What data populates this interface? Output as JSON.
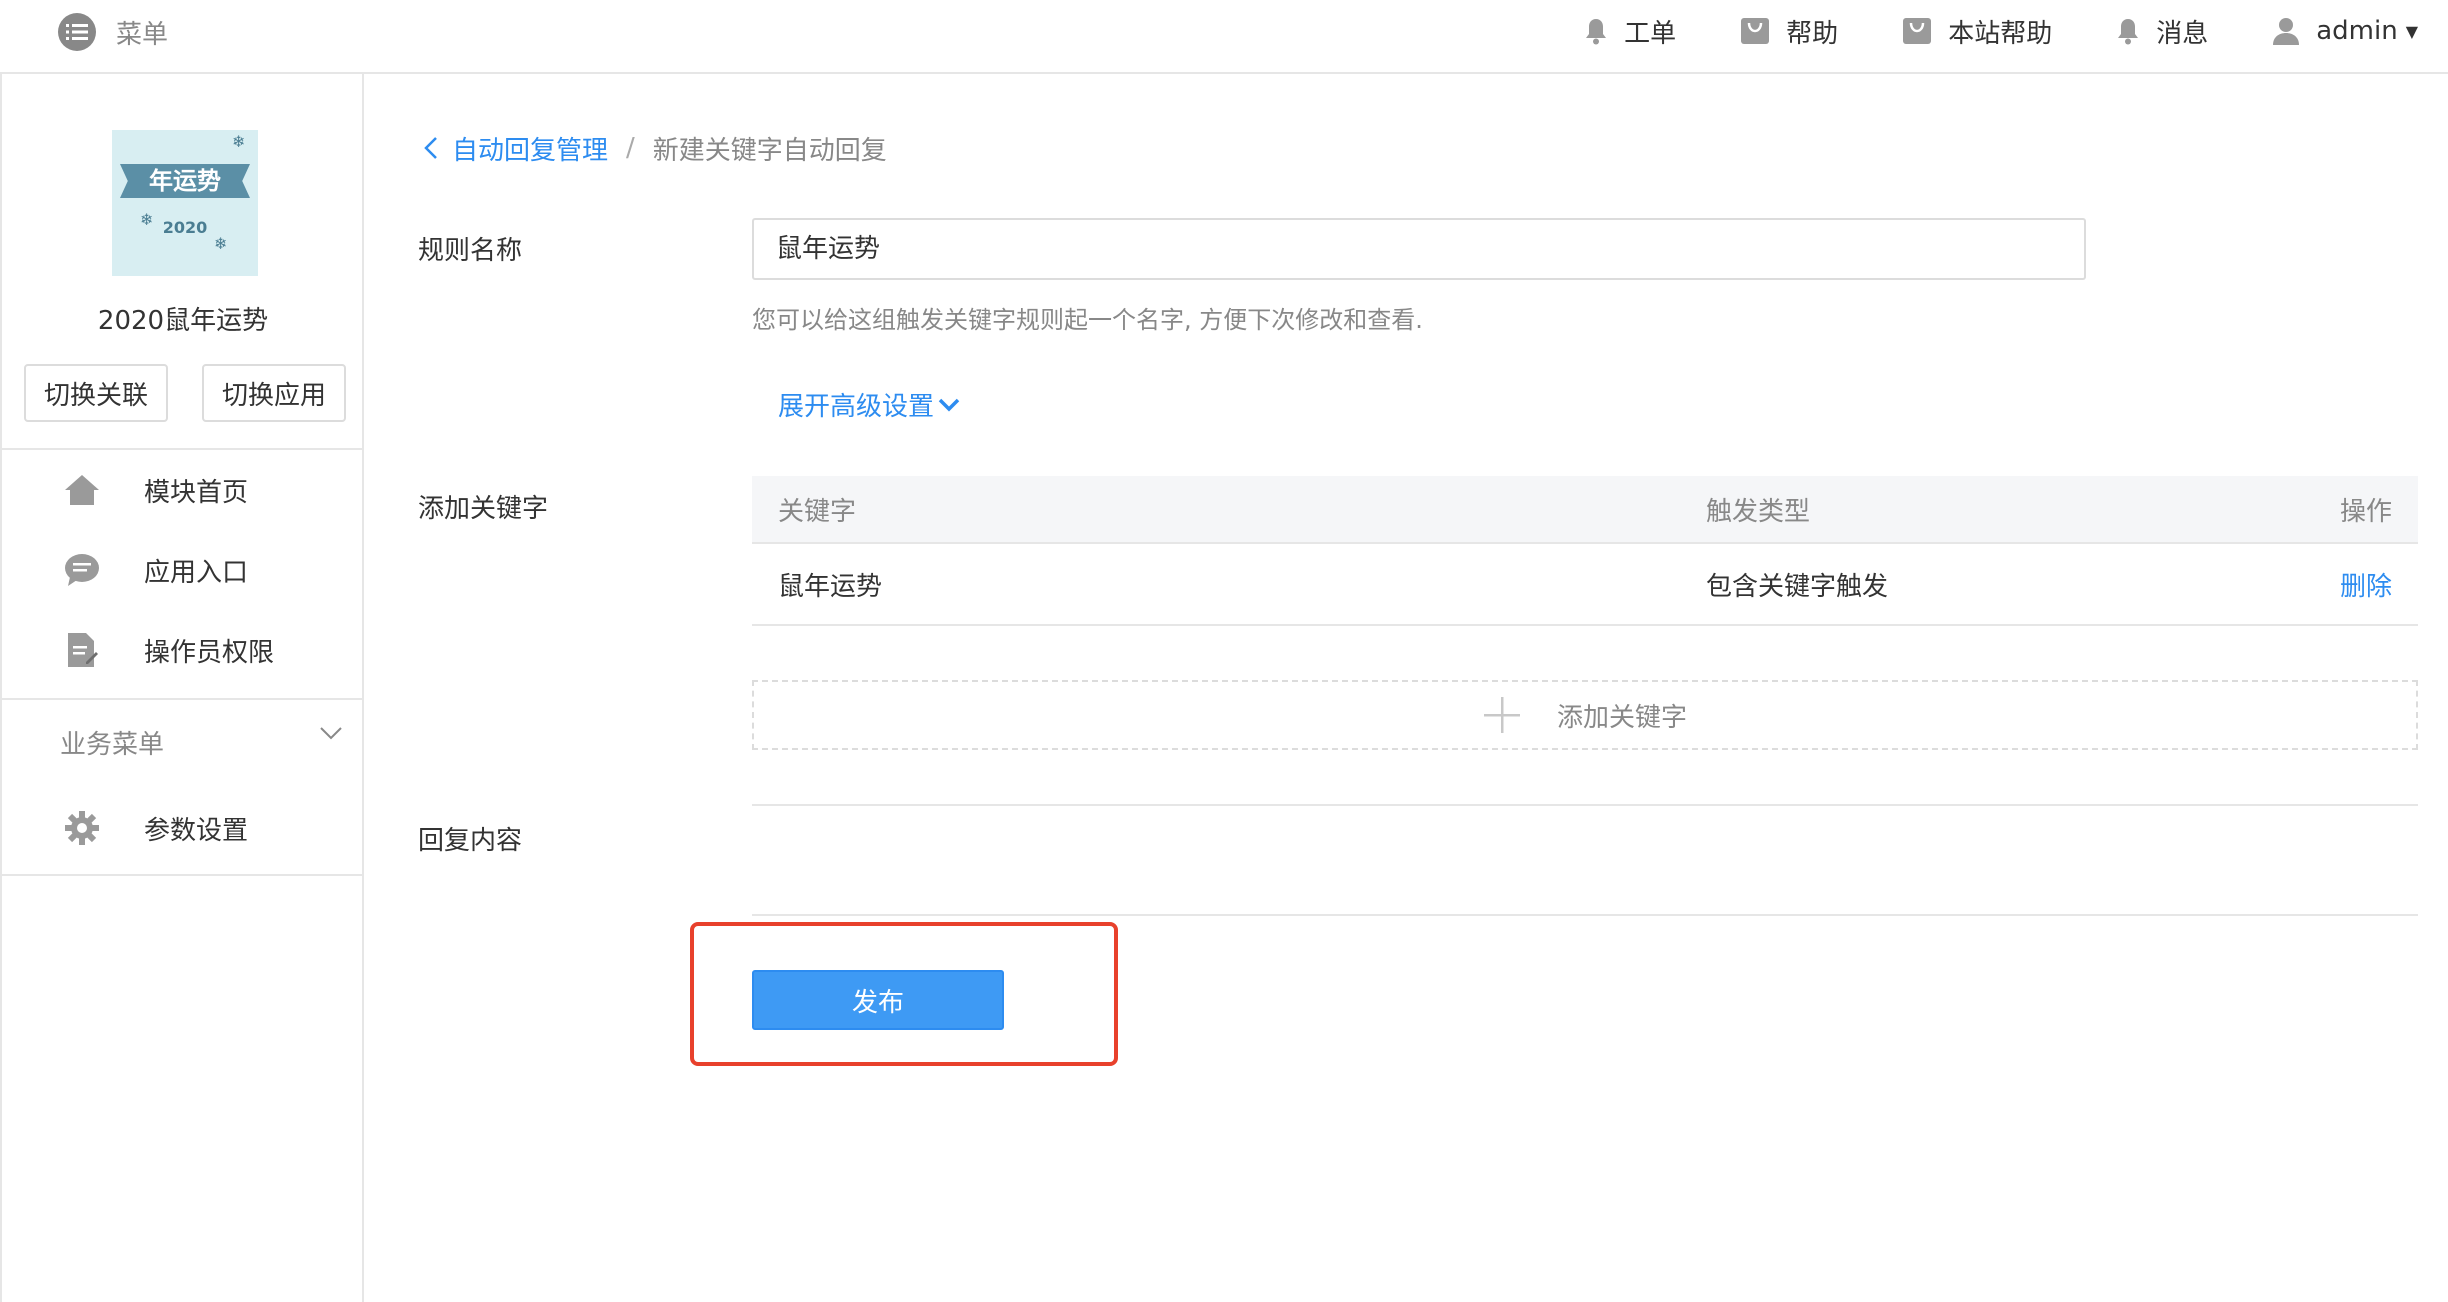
{
  "topbar": {
    "menu_label": "菜单",
    "items": [
      {
        "label": "工单",
        "icon": "bell-icon"
      },
      {
        "label": "帮助",
        "icon": "bag-icon"
      },
      {
        "label": "本站帮助",
        "icon": "bag-icon"
      },
      {
        "label": "消息",
        "icon": "bell-icon"
      },
      {
        "label": "admin",
        "icon": "user-icon"
      }
    ]
  },
  "sidebar": {
    "app_logo": {
      "title": "年运势",
      "year": "2020"
    },
    "app_name": "2020鼠年运势",
    "switch_link_label": "切换关联",
    "switch_app_label": "切换应用",
    "nav": [
      {
        "label": "模块首页",
        "icon": "home-icon"
      },
      {
        "label": "应用入口",
        "icon": "chat-bubble-icon"
      },
      {
        "label": "操作员权限",
        "icon": "document-edit-icon"
      }
    ],
    "group_title": "业务菜单",
    "group_items": [
      {
        "label": "参数设置",
        "icon": "gear-icon"
      }
    ]
  },
  "breadcrumb": {
    "parent": "自动回复管理",
    "separator": "/",
    "current": "新建关键字自动回复"
  },
  "form": {
    "rule_name_label": "规则名称",
    "rule_name_value": "鼠年运势",
    "rule_name_hint": "您可以给这组触发关键字规则起一个名字, 方便下次修改和查看.",
    "advanced_label": "展开高级设置",
    "add_keyword_label": "添加关键字",
    "table": {
      "columns": [
        "关键字",
        "触发类型",
        "操作"
      ],
      "rows": [
        {
          "keyword": "鼠年运势",
          "type": "包含关键字触发",
          "action": "删除"
        }
      ]
    },
    "add_keyword_button": "添加关键字",
    "reply_content_label": "回复内容",
    "publish_label": "发布"
  },
  "colors": {
    "accent": "#2d8cf0",
    "publish_bg": "#3e9af4",
    "highlight": "#e8412c",
    "muted": "#888888"
  }
}
